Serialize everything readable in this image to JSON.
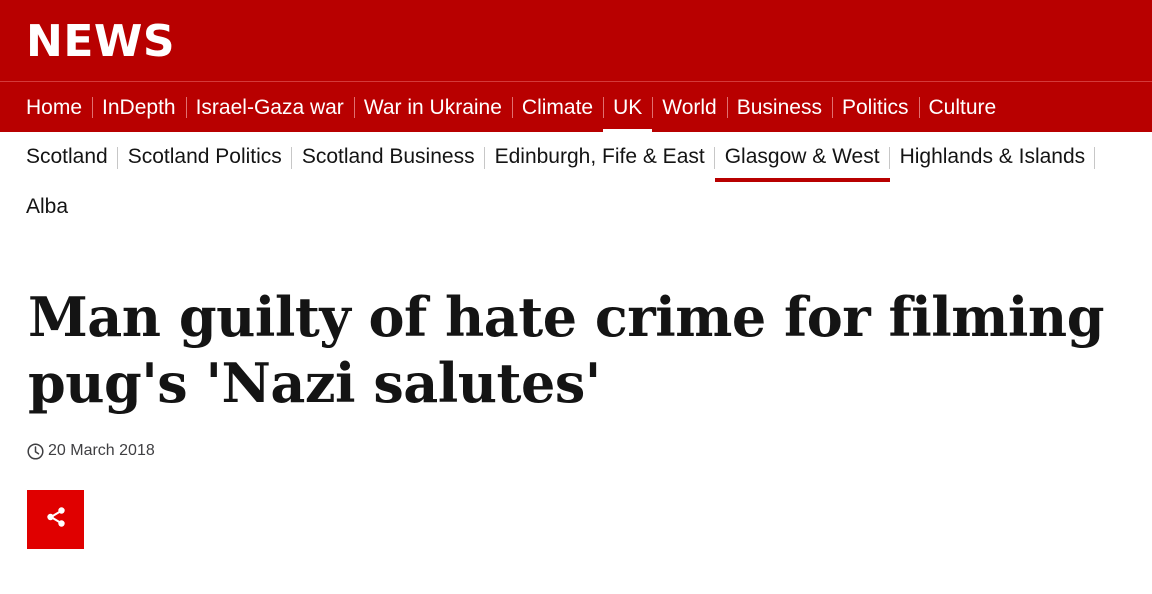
{
  "brand": {
    "logo_text": "NEWS"
  },
  "primary_nav": [
    {
      "label": "Home",
      "active": false
    },
    {
      "label": "InDepth",
      "active": false
    },
    {
      "label": "Israel-Gaza war",
      "active": false
    },
    {
      "label": "War in Ukraine",
      "active": false
    },
    {
      "label": "Climate",
      "active": false
    },
    {
      "label": "UK",
      "active": true
    },
    {
      "label": "World",
      "active": false
    },
    {
      "label": "Business",
      "active": false
    },
    {
      "label": "Politics",
      "active": false
    },
    {
      "label": "Culture",
      "active": false
    }
  ],
  "secondary_nav": [
    {
      "label": "Scotland",
      "active": false
    },
    {
      "label": "Scotland Politics",
      "active": false
    },
    {
      "label": "Scotland Business",
      "active": false
    },
    {
      "label": "Edinburgh, Fife & East",
      "active": false
    },
    {
      "label": "Glasgow & West",
      "active": true
    },
    {
      "label": "Highlands & Islands",
      "active": false
    },
    {
      "label": "Alba",
      "active": false
    }
  ],
  "article": {
    "headline": "Man guilty of hate crime for filming pug's 'Nazi salutes'",
    "date": "20 March 2018"
  },
  "colors": {
    "masthead": "#b80000",
    "share_button": "#e00000",
    "active_underline": "#b80000"
  },
  "icons": {
    "date_icon": "clock-icon",
    "share_icon": "share-icon"
  }
}
